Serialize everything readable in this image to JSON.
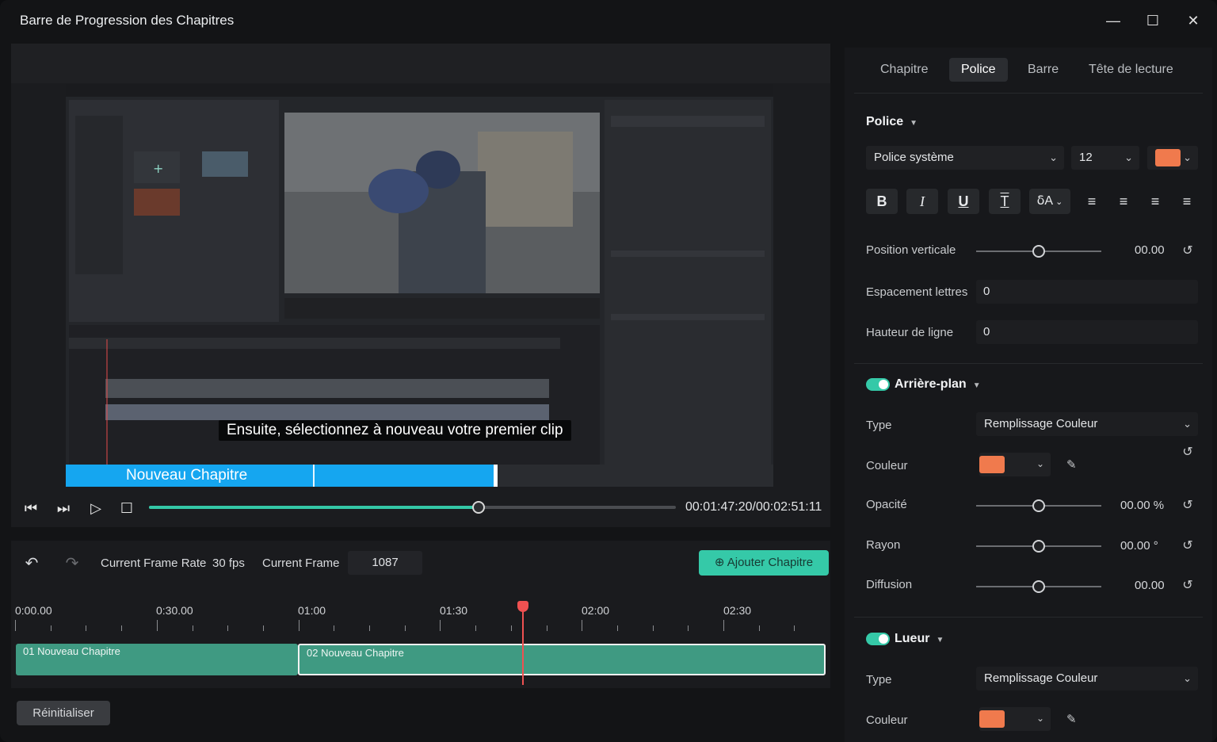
{
  "window": {
    "title": "Barre de Progression des Chapitres",
    "controls": [
      "—",
      "☐",
      "✕"
    ]
  },
  "preview": {
    "subtitle": "Ensuite, sélectionnez à nouveau votre premier clip",
    "chapter_label": "Nouveau Chapitre",
    "playback_progress": 0.625,
    "timecode": "00:01:47:20/00:02:51:11"
  },
  "timeline": {
    "frame_rate_label": "Current Frame Rate",
    "frame_rate_value": "30 fps",
    "current_frame_label": "Current Frame",
    "current_frame_value": "1087",
    "add_chapter_label": "Ajouter Chapitre",
    "ruler_labels": [
      "0:00.00",
      "0:30.00",
      "01:00",
      "01:30",
      "02:00",
      "02:30"
    ],
    "clips": [
      "01 Nouveau Chapitre",
      "02 Nouveau Chapitre"
    ],
    "reset_label": "Réinitialiser"
  },
  "panel": {
    "tabs": [
      "Chapitre",
      "Police",
      "Barre",
      "Tête de lecture"
    ],
    "active_tab": "Police",
    "font_section": "Police",
    "font_family": "Police système",
    "font_size": "12",
    "font_color": "#f07a4d",
    "format_buttons": [
      "B",
      "I",
      "U",
      "T",
      "ẟA",
      "≡",
      "≡",
      "≡",
      "≡"
    ],
    "vertical_position_label": "Position verticale",
    "vertical_position_value": "00.00",
    "vertical_position": 0.5,
    "letter_spacing_label": "Espacement lettres",
    "letter_spacing_value": "0",
    "line_height_label": "Hauteur de ligne",
    "line_height_value": "0",
    "background_section": "Arrière-plan",
    "background_enabled": true,
    "bg_type_label": "Type",
    "bg_type_value": "Remplissage Couleur",
    "bg_color_label": "Couleur",
    "bg_color": "#f07a4d",
    "opacity_label": "Opacité",
    "opacity_value": "00.00 %",
    "opacity": 0.5,
    "radius_label": "Rayon",
    "radius_value": "00.00 °",
    "radius": 0.5,
    "diffusion_label": "Diffusion",
    "diffusion_value": "00.00",
    "diffusion": 0.5,
    "glow_section": "Lueur",
    "glow_enabled": true,
    "glow_type_label": "Type",
    "glow_type_value": "Remplissage Couleur",
    "glow_color_label": "Couleur",
    "glow_color": "#f07a4d"
  }
}
